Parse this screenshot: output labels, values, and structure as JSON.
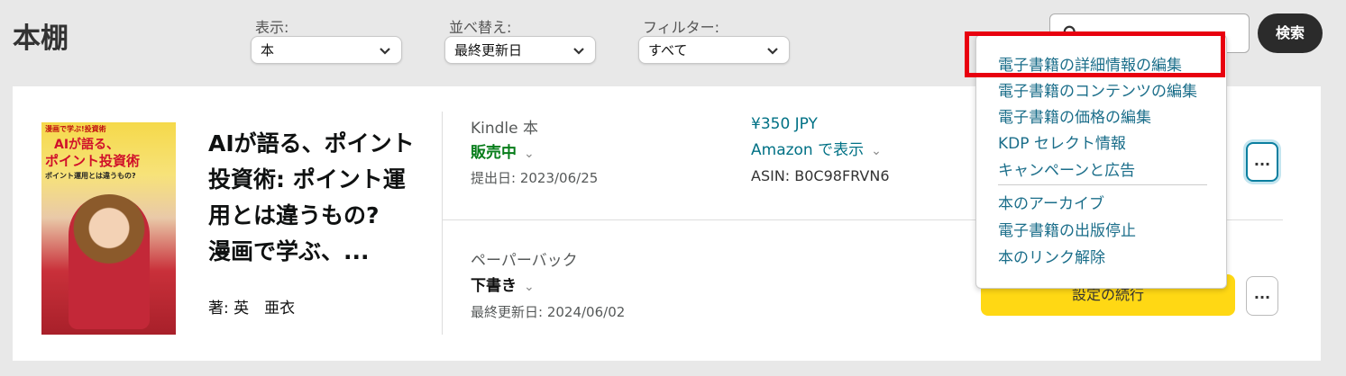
{
  "header": {
    "title": "本棚",
    "display": {
      "label": "表示:",
      "value": "本"
    },
    "sort": {
      "label": "並べ替え:",
      "value": "最終更新日"
    },
    "filter": {
      "label": "フィルター:",
      "value": "すべて"
    },
    "search": {
      "button_label": "検索"
    }
  },
  "book": {
    "title": "AIが語る、ポイント投資術: ポイント運用とは違うもの?　漫画で学ぶ、...",
    "author": "著: 英　亜衣",
    "cover_text": [
      "漫画で学ぶ!投資術",
      "AIが語る、",
      "ポイント投資術",
      "ポイント運用とは違うもの?"
    ],
    "kindle": {
      "format": "Kindle 本",
      "status": "販売中",
      "submitted": "提出日: 2023/06/25",
      "price": "¥350 JPY",
      "amazon_link": "Amazon で表示",
      "asin": "ASIN: B0C98FRVN6"
    },
    "paperback": {
      "format": "ペーパーバック",
      "status": "下書き",
      "updated": "最終更新日: 2024/06/02",
      "continue_label": "設定の続行"
    }
  },
  "more_label": "...",
  "menu": {
    "items_top": [
      "電子書籍の詳細情報の編集",
      "電子書籍のコンテンツの編集",
      "電子書籍の価格の編集",
      "KDP セレクト情報",
      "キャンペーンと広告"
    ],
    "items_bottom": [
      "本のアーカイブ",
      "電子書籍の出版停止",
      "本のリンク解除"
    ]
  },
  "colors": {
    "status_live": "#067d1a",
    "link": "#007185",
    "button_yellow": "#ffd814",
    "highlight": "#e8000f"
  }
}
